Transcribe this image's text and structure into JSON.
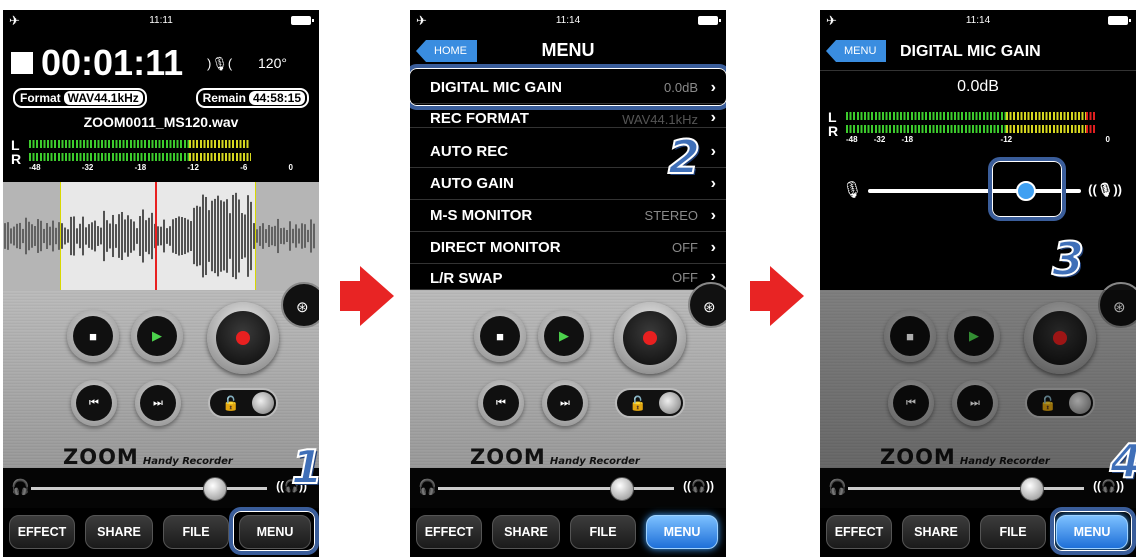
{
  "status_time_1": "11:11",
  "status_time_2": "11:14",
  "status_time_3": "11:14",
  "panel1": {
    "counter": "00:01:11",
    "angle": "120°",
    "format_label": "Format",
    "format_value": "WAV44.1kHz",
    "remain_label": "Remain",
    "remain_value": "44:58:15",
    "filename": "ZOOM0011_MS120.wav",
    "scale": [
      "-48",
      "-32",
      "-18",
      "-12",
      "-6",
      "0"
    ]
  },
  "device": {
    "logo": "ZOOM",
    "logo_sub": "Handy Recorder"
  },
  "bottom_buttons": [
    "EFFECT",
    "SHARE",
    "FILE",
    "MENU"
  ],
  "panel2": {
    "back_label": "HOME",
    "title": "MENU",
    "items": [
      {
        "label": "DIGITAL MIC GAIN",
        "value": "0.0dB"
      },
      {
        "label": "REC FORMAT",
        "value": "WAV44.1kHz"
      },
      {
        "label": "AUTO REC",
        "value": ""
      },
      {
        "label": "AUTO GAIN",
        "value": ""
      },
      {
        "label": "M-S MONITOR",
        "value": "STEREO"
      },
      {
        "label": "DIRECT MONITOR",
        "value": "OFF"
      },
      {
        "label": "L/R SWAP",
        "value": "OFF"
      }
    ]
  },
  "panel3": {
    "back_label": "MENU",
    "title": "DIGITAL MIC GAIN",
    "gain_value": "0.0dB",
    "scale": [
      "-48",
      "-32",
      "-18",
      "-12",
      "0"
    ]
  },
  "steps": [
    "1",
    "2",
    "3",
    "4"
  ],
  "colors": {
    "highlight": "#3a5d9a",
    "accent": "#1e6fd8",
    "arrow": "#e82424",
    "rec": "#e82020"
  }
}
